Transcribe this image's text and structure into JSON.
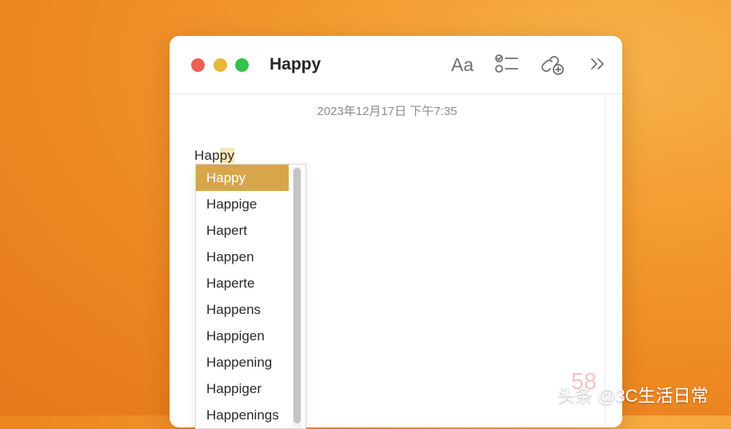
{
  "window": {
    "title": "Happy",
    "toolbar": {
      "font_label": "Aa",
      "icons": [
        "checklist-icon",
        "collaborate-icon",
        "more-chevron-icon"
      ]
    }
  },
  "note": {
    "date": "2023年12月17日 下午7:35",
    "text_prefix": "Hap",
    "text_highlight": "py"
  },
  "autocomplete": {
    "items": [
      {
        "label": "Happy"
      },
      {
        "label": "Happige"
      },
      {
        "label": "Hapert"
      },
      {
        "label": "Happen"
      },
      {
        "label": "Haperte"
      },
      {
        "label": "Happens"
      },
      {
        "label": "Happigen"
      },
      {
        "label": "Happening"
      },
      {
        "label": "Happiger"
      },
      {
        "label": "Happenings"
      }
    ],
    "selected_index": 0,
    "accent_color": "#d7a54a"
  },
  "watermark": {
    "faint_text": "58",
    "text": "头条 @3C生活日常"
  }
}
